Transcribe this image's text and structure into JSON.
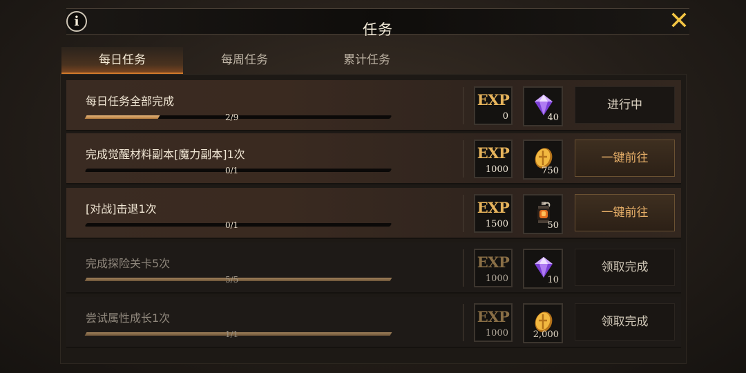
{
  "header": {
    "title": "任务",
    "info_label": "i",
    "close_label": "✕"
  },
  "tabs": [
    {
      "label": "每日任务",
      "active": true
    },
    {
      "label": "每周任务",
      "active": false
    },
    {
      "label": "累计任务",
      "active": false
    }
  ],
  "tasks": [
    {
      "title": "每日任务全部完成",
      "progress": "2/9",
      "progress_fraction": 0.24,
      "exp_label": "EXP",
      "exp": "0",
      "reward_icon": "purple-gem-icon",
      "reward_qty": "40",
      "action": "进行中",
      "state": "in-progress"
    },
    {
      "title": "完成觉醒材料副本[魔力副本]1次",
      "progress": "0/1",
      "progress_fraction": 0,
      "exp_label": "EXP",
      "exp": "1000",
      "reward_icon": "gold-coin-icon",
      "reward_qty": "750",
      "action": "一键前往",
      "state": "go"
    },
    {
      "title": "[对战]击退1次",
      "progress": "0/1",
      "progress_fraction": 0,
      "exp_label": "EXP",
      "exp": "1500",
      "reward_icon": "lantern-icon",
      "reward_qty": "50",
      "action": "一键前往",
      "state": "go"
    },
    {
      "title": "完成探险关卡5次",
      "progress": "5/5",
      "progress_fraction": 1,
      "exp_label": "EXP",
      "exp": "1000",
      "reward_icon": "purple-gem-icon",
      "reward_qty": "10",
      "action": "领取完成",
      "state": "claimed"
    },
    {
      "title": "尝试属性成长1次",
      "progress": "1/1",
      "progress_fraction": 1,
      "exp_label": "EXP",
      "exp": "1000",
      "reward_icon": "gold-coin-icon",
      "reward_qty": "2,000",
      "action": "领取完成",
      "state": "claimed"
    }
  ],
  "colors": {
    "accent_gold": "#e7b45c",
    "close_yellow": "#f2c443",
    "tab_active_underline": "#d07a2c"
  }
}
